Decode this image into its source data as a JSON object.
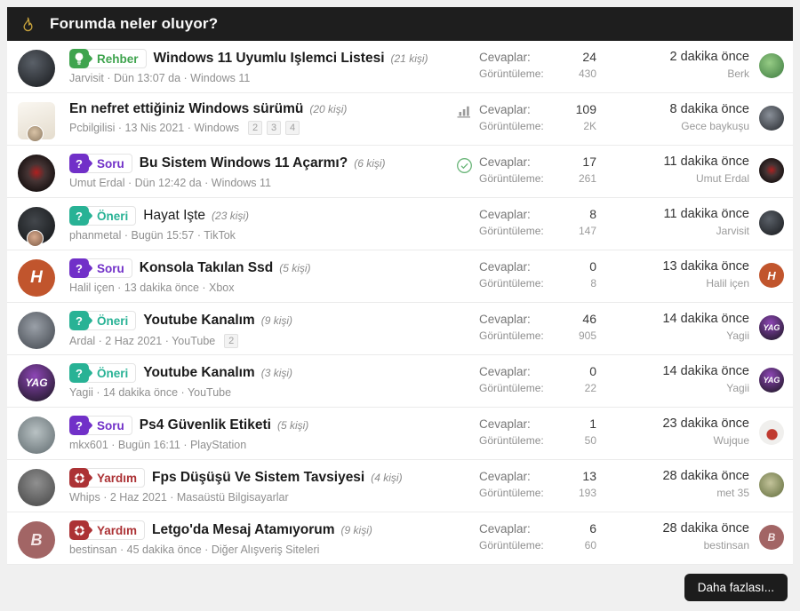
{
  "header": {
    "title": "Forumda neler oluyor?"
  },
  "labels": {
    "replies": "Cevaplar:",
    "views": "Görüntüleme:"
  },
  "footer": {
    "more_label": "Daha fazlası..."
  },
  "colors": {
    "badge_rehber": "#3fa44e",
    "badge_soru": "#7130c8",
    "badge_oneri": "#28b295",
    "badge_yardim": "#ac3235",
    "header_bg": "#1e1e1e",
    "check_green": "#69b578"
  },
  "threads": [
    {
      "badge": "Rehber",
      "badge_color": "#3fa44e",
      "badge_icon": "lightbulb-icon",
      "title": "Windows 11 Uyumlu Işlemci Listesi",
      "title_bold": true,
      "participants": "(21 kişi)",
      "meta": "Jarvisit · Dün 13:07 da · Windows 11",
      "pages": [],
      "row_icon": null,
      "replies": "24",
      "views": "430",
      "time": "2 dakika önce",
      "last_user": "Berk",
      "avatar": {
        "bg": "radial-gradient(circle at 40% 35%, #5a6068, #16181b)"
      },
      "mini_avatar": {
        "bg": "radial-gradient(circle at 42% 38%, #96cc85, #3c7a3f)"
      }
    },
    {
      "badge": null,
      "title": "En nefret ettiğiniz Windows sürümü",
      "title_bold": true,
      "participants": "(20 kişi)",
      "meta": "Pcbilgilisi · 13 Nis 2021 · Windows",
      "pages": [
        "2",
        "3",
        "4"
      ],
      "row_icon": "bar-chart-icon",
      "replies": "109",
      "views": "2K",
      "time": "8 dakika önce",
      "last_user": "Gece baykuşu",
      "avatar": {
        "bg": "linear-gradient(160deg, #faf7f1, #e4dccd)",
        "shape": "square",
        "overlay": "radial-gradient(circle at 45% 40%, #d9c3a6, #8d7a62)"
      },
      "mini_avatar": {
        "bg": "radial-gradient(circle at 42% 38%, #8a9099, #23262b)"
      }
    },
    {
      "badge": "Soru",
      "badge_color": "#7130c8",
      "badge_icon": "question-icon",
      "title": "Bu Sistem Windows 11 Açarmı?",
      "title_bold": true,
      "participants": "(6 kişi)",
      "meta": "Umut Erdal · Dün 12:42 da · Windows 11",
      "pages": [],
      "row_icon": "check-circle-icon",
      "replies": "17",
      "views": "261",
      "time": "11 dakika önce",
      "last_user": "Umut Erdal",
      "avatar": {
        "bg": "radial-gradient(circle at 50% 48%, #b02020 0%, #453434 32%, #161010 78%)"
      },
      "mini_avatar": {
        "bg": "radial-gradient(circle at 50% 48%, #b02020 0%, #453434 32%, #161010 78%)"
      }
    },
    {
      "badge": "Öneri",
      "badge_color": "#28b295",
      "badge_icon": "question-icon",
      "title": "Hayat Işte",
      "title_bold": false,
      "participants": "(23 kişi)",
      "meta": "phanmetal · Bugün 15:57 · TikTok",
      "pages": [],
      "row_icon": null,
      "replies": "8",
      "views": "147",
      "time": "11 dakika önce",
      "last_user": "Jarvisit",
      "avatar": {
        "bg": "radial-gradient(circle at 45% 38%, #43474c, #101214)",
        "overlay": "radial-gradient(circle at 45% 40%, #d9ab8e, #7c5a46)"
      },
      "mini_avatar": {
        "bg": "radial-gradient(circle at 40% 35%, #5a6068, #16181b)"
      }
    },
    {
      "badge": "Soru",
      "badge_color": "#7130c8",
      "badge_icon": "question-icon",
      "title": "Konsola Takılan Ssd",
      "title_bold": true,
      "participants": "(5 kişi)",
      "meta": "Halil içen · 13 dakika önce · Xbox",
      "pages": [],
      "row_icon": null,
      "replies": "0",
      "views": "8",
      "time": "13 dakika önce",
      "last_user": "Halil içen",
      "avatar": {
        "bg": "#c1552d",
        "text": "H",
        "font": "19px"
      },
      "mini_avatar": {
        "bg": "#c1552d",
        "text": "H",
        "font": "13px"
      }
    },
    {
      "badge": "Öneri",
      "badge_color": "#28b295",
      "badge_icon": "question-icon",
      "title": "Youtube Kanalım",
      "title_bold": true,
      "participants": "(9 kişi)",
      "meta": "Ardal · 2 Haz 2021 · YouTube",
      "pages": [
        "2"
      ],
      "row_icon": null,
      "replies": "46",
      "views": "905",
      "time": "14 dakika önce",
      "last_user": "Yagii",
      "avatar": {
        "bg": "radial-gradient(circle at 45% 40%, #9aa0a8, #3f444b)"
      },
      "mini_avatar": {
        "bg": "radial-gradient(circle at 45% 32%, #8d46b5, #17141c)",
        "text": "YAG",
        "font": "9px"
      }
    },
    {
      "badge": "Öneri",
      "badge_color": "#28b295",
      "badge_icon": "question-icon",
      "title": "Youtube Kanalım",
      "title_bold": true,
      "participants": "(3 kişi)",
      "meta": "Yagii · 14 dakika önce · YouTube",
      "pages": [],
      "row_icon": null,
      "replies": "0",
      "views": "22",
      "time": "14 dakika önce",
      "last_user": "Yagii",
      "avatar": {
        "bg": "radial-gradient(circle at 45% 32%, #8d46b5, #17141c)",
        "text": "YAG",
        "font": "12px"
      },
      "mini_avatar": {
        "bg": "radial-gradient(circle at 45% 32%, #8d46b5, #17141c)",
        "text": "YAG",
        "font": "9px"
      }
    },
    {
      "badge": "Soru",
      "badge_color": "#7130c8",
      "badge_icon": "question-icon",
      "title": "Ps4 Güvenlik Etiketi",
      "title_bold": true,
      "participants": "(5 kişi)",
      "meta": "mkx601 · Bugün 16:11 · PlayStation",
      "pages": [],
      "row_icon": null,
      "replies": "1",
      "views": "50",
      "time": "23 dakika önce",
      "last_user": "Wujque",
      "avatar": {
        "bg": "radial-gradient(circle at 48% 42%, #b9c2c4, #5f6a6e)"
      },
      "mini_avatar": {
        "bg": "radial-gradient(circle at 52% 58%, #c03a30 0%, #c03a30 26%, #f0efed 30%)"
      }
    },
    {
      "badge": "Yardım",
      "badge_color": "#ac3235",
      "badge_icon": "lifebuoy-icon",
      "title": "Fps Düşüşü Ve Sistem Tavsiyesi",
      "title_bold": true,
      "participants": "(4 kişi)",
      "meta": "Whips · 2 Haz 2021 · Masaüstü Bilgisayarlar",
      "pages": [],
      "row_icon": null,
      "replies": "13",
      "views": "193",
      "time": "28 dakika önce",
      "last_user": "met 35",
      "avatar": {
        "bg": "radial-gradient(circle at 50% 38%, #909090, #444)"
      },
      "mini_avatar": {
        "bg": "radial-gradient(circle at 45% 42%, #c3c39a, #5f6b3a)"
      }
    },
    {
      "badge": "Yardım",
      "badge_color": "#ac3235",
      "badge_icon": "lifebuoy-icon",
      "title": "Letgo'da Mesaj Atamıyorum",
      "title_bold": true,
      "participants": "(9 kişi)",
      "meta": "bestinsan · 45 dakika önce · Diğer Alışveriş Siteleri",
      "pages": [],
      "row_icon": null,
      "replies": "6",
      "views": "60",
      "time": "28 dakika önce",
      "last_user": "bestinsan",
      "avatar": {
        "bg": "#a26565",
        "text": "B",
        "font": "18px",
        "fg": "#f3e4e4"
      },
      "mini_avatar": {
        "bg": "#a26565",
        "text": "B",
        "font": "12px",
        "fg": "#f3e4e4"
      }
    }
  ]
}
